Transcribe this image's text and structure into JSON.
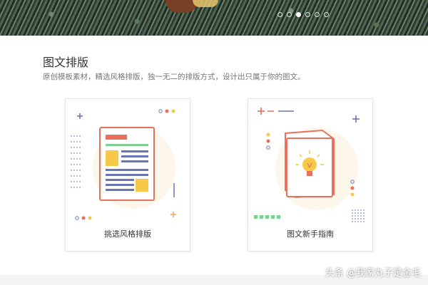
{
  "banner": {
    "carousel": {
      "count": 6,
      "active_index": 2
    }
  },
  "section": {
    "title": "图文排版",
    "subtitle": "原创模板素材，精选风格排版，独一无二的排版方式，设计出只属于你的图文。"
  },
  "cards": [
    {
      "label": "挑选风格排版",
      "icon": "layout-template-icon"
    },
    {
      "label": "图文新手指南",
      "icon": "guide-book-icon"
    }
  ],
  "watermark": "头条 @我家丸子是金毛",
  "colors": {
    "accent_red": "#e8705d",
    "accent_orange": "#f4a25a",
    "accent_yellow": "#f7c948",
    "accent_blue": "#6a75b5",
    "accent_green": "#7ccf8f",
    "card_circle": "#fdf6ea"
  }
}
